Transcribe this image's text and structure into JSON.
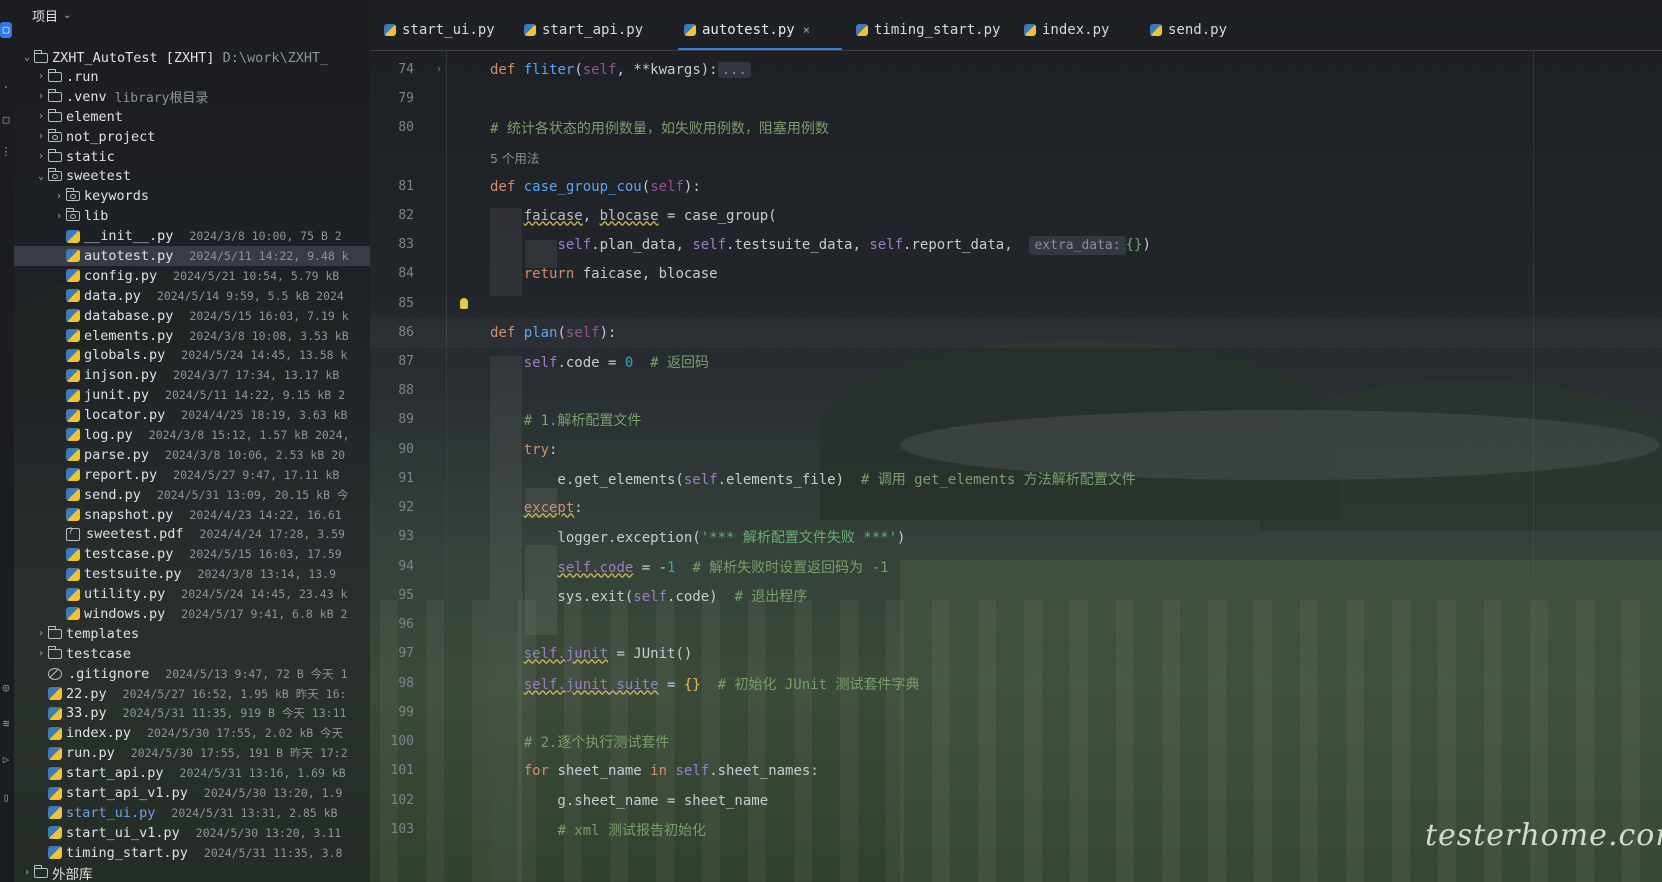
{
  "project_panel": {
    "title": "项目",
    "root": {
      "name": "ZXHT_AutoTest [ZXHT]",
      "path": "D:\\work\\ZXHT_"
    },
    "items": [
      {
        "name": ".run",
        "type": "folder",
        "depth": 1,
        "arrow": "›"
      },
      {
        "name": ".venv",
        "note": "library根目录",
        "type": "folder",
        "depth": 1,
        "arrow": "›"
      },
      {
        "name": "element",
        "type": "folder",
        "depth": 1,
        "arrow": "›"
      },
      {
        "name": "not_project",
        "type": "pkg",
        "depth": 1,
        "arrow": "›"
      },
      {
        "name": "static",
        "type": "folder",
        "depth": 1,
        "arrow": "›"
      },
      {
        "name": "sweetest",
        "type": "pkg",
        "depth": 1,
        "arrow": "⌄"
      },
      {
        "name": "keywords",
        "type": "pkg",
        "depth": 2,
        "arrow": "›"
      },
      {
        "name": "lib",
        "type": "pkg",
        "depth": 2,
        "arrow": "›"
      },
      {
        "name": "__init__.py",
        "meta": "2024/3/8 10:00, 75 B 2",
        "type": "py",
        "depth": 2
      },
      {
        "name": "autotest.py",
        "meta": "2024/5/11 14:22, 9.48 k",
        "type": "py",
        "depth": 2,
        "selected": true
      },
      {
        "name": "config.py",
        "meta": "2024/5/21 10:54, 5.79 kB",
        "type": "py",
        "depth": 2
      },
      {
        "name": "data.py",
        "meta": "2024/5/14 9:59, 5.5 kB 2024",
        "type": "py",
        "depth": 2
      },
      {
        "name": "database.py",
        "meta": "2024/5/15 16:03, 7.19 k",
        "type": "py",
        "depth": 2
      },
      {
        "name": "elements.py",
        "meta": "2024/3/8 10:08, 3.53 kB",
        "type": "py",
        "depth": 2
      },
      {
        "name": "globals.py",
        "meta": "2024/5/24 14:45, 13.58 k",
        "type": "py",
        "depth": 2
      },
      {
        "name": "injson.py",
        "meta": "2024/3/7 17:34, 13.17 kB",
        "type": "py",
        "depth": 2
      },
      {
        "name": "junit.py",
        "meta": "2024/5/11 14:22, 9.15 kB 2",
        "type": "py",
        "depth": 2
      },
      {
        "name": "locator.py",
        "meta": "2024/4/25 18:19, 3.63 kB",
        "type": "py",
        "depth": 2
      },
      {
        "name": "log.py",
        "meta": "2024/3/8 15:12, 1.57 kB 2024,",
        "type": "py",
        "depth": 2
      },
      {
        "name": "parse.py",
        "meta": "2024/3/8 10:06, 2.53 kB 20",
        "type": "py",
        "depth": 2
      },
      {
        "name": "report.py",
        "meta": "2024/5/27 9:47, 17.11 kB",
        "type": "py",
        "depth": 2
      },
      {
        "name": "send.py",
        "meta": "2024/5/31 13:09, 20.15 kB 今",
        "type": "py",
        "depth": 2
      },
      {
        "name": "snapshot.py",
        "meta": "2024/4/23 14:22, 16.61",
        "type": "py",
        "depth": 2
      },
      {
        "name": "sweetest.pdf",
        "meta": "2024/4/24 17:28, 3.59",
        "type": "pdf",
        "depth": 2
      },
      {
        "name": "testcase.py",
        "meta": "2024/5/15 16:03, 17.59",
        "type": "py",
        "depth": 2
      },
      {
        "name": "testsuite.py",
        "meta": "2024/3/8 13:14, 13.9",
        "type": "py",
        "depth": 2
      },
      {
        "name": "utility.py",
        "meta": "2024/5/24 14:45, 23.43 k",
        "type": "py",
        "depth": 2
      },
      {
        "name": "windows.py",
        "meta": "2024/5/17 9:41, 6.8 kB 2",
        "type": "py",
        "depth": 2
      },
      {
        "name": "templates",
        "type": "folder",
        "depth": 1,
        "arrow": "›"
      },
      {
        "name": "testcase",
        "type": "folder",
        "depth": 1,
        "arrow": "›"
      },
      {
        "name": ".gitignore",
        "meta": "2024/5/13 9:47, 72 B 今天 1",
        "type": "ignore",
        "depth": 1
      },
      {
        "name": "22.py",
        "meta": "2024/5/27 16:52, 1.95 kB 昨天 16:",
        "type": "py",
        "depth": 1
      },
      {
        "name": "33.py",
        "meta": "2024/5/31 11:35, 919 B 今天 13:11",
        "type": "py",
        "depth": 1
      },
      {
        "name": "index.py",
        "meta": "2024/5/30 17:55, 2.02 kB 今天",
        "type": "py",
        "depth": 1
      },
      {
        "name": "run.py",
        "meta": "2024/5/30 17:55, 191 B 昨天 17:2",
        "type": "py",
        "depth": 1
      },
      {
        "name": "start_api.py",
        "meta": "2024/5/31 13:16, 1.69 kB",
        "type": "py",
        "depth": 1
      },
      {
        "name": "start_api_v1.py",
        "meta": "2024/5/30 13:20, 1.9",
        "type": "py",
        "depth": 1
      },
      {
        "name": "start_ui.py",
        "meta": "2024/5/31 13:31, 2.85 kB",
        "type": "py",
        "depth": 1,
        "modified": true
      },
      {
        "name": "start_ui_v1.py",
        "meta": "2024/5/30 13:20, 3.11",
        "type": "py",
        "depth": 1
      },
      {
        "name": "timing_start.py",
        "meta": "2024/5/31 11:35, 3.8",
        "type": "py",
        "depth": 1
      },
      {
        "name": "外部库",
        "type": "folder",
        "depth": 0,
        "arrow": "›"
      }
    ]
  },
  "tabs": [
    {
      "label": "start_ui.py",
      "active": false
    },
    {
      "label": "start_api.py",
      "active": false
    },
    {
      "label": "autotest.py",
      "active": true,
      "close": "×"
    },
    {
      "label": "timing_start.py",
      "active": false
    },
    {
      "label": "index.py",
      "active": false
    },
    {
      "label": "send.py",
      "active": false
    }
  ],
  "editor": {
    "usages_hint": "5 个用法",
    "param_hint": "extra_data:",
    "lines": [
      {
        "n": "74"
      },
      {
        "n": "79"
      },
      {
        "n": "80"
      },
      {
        "n": ""
      },
      {
        "n": "81"
      },
      {
        "n": "82"
      },
      {
        "n": "83"
      },
      {
        "n": "84"
      },
      {
        "n": "85"
      },
      {
        "n": "86"
      },
      {
        "n": "87"
      },
      {
        "n": "88"
      },
      {
        "n": "89"
      },
      {
        "n": "90"
      },
      {
        "n": "91"
      },
      {
        "n": "92"
      },
      {
        "n": "93"
      },
      {
        "n": "94"
      },
      {
        "n": "95"
      },
      {
        "n": "96"
      },
      {
        "n": "97"
      },
      {
        "n": "98"
      },
      {
        "n": "99"
      },
      {
        "n": "100"
      },
      {
        "n": "101"
      },
      {
        "n": "102"
      },
      {
        "n": "103"
      }
    ]
  },
  "watermark": "testerhome.com",
  "colors": {
    "accent": "#3d7ad9",
    "keyword": "#cf8e6d",
    "function": "#56a8f5",
    "comment": "#7a9f6b",
    "self": "#94558d"
  }
}
